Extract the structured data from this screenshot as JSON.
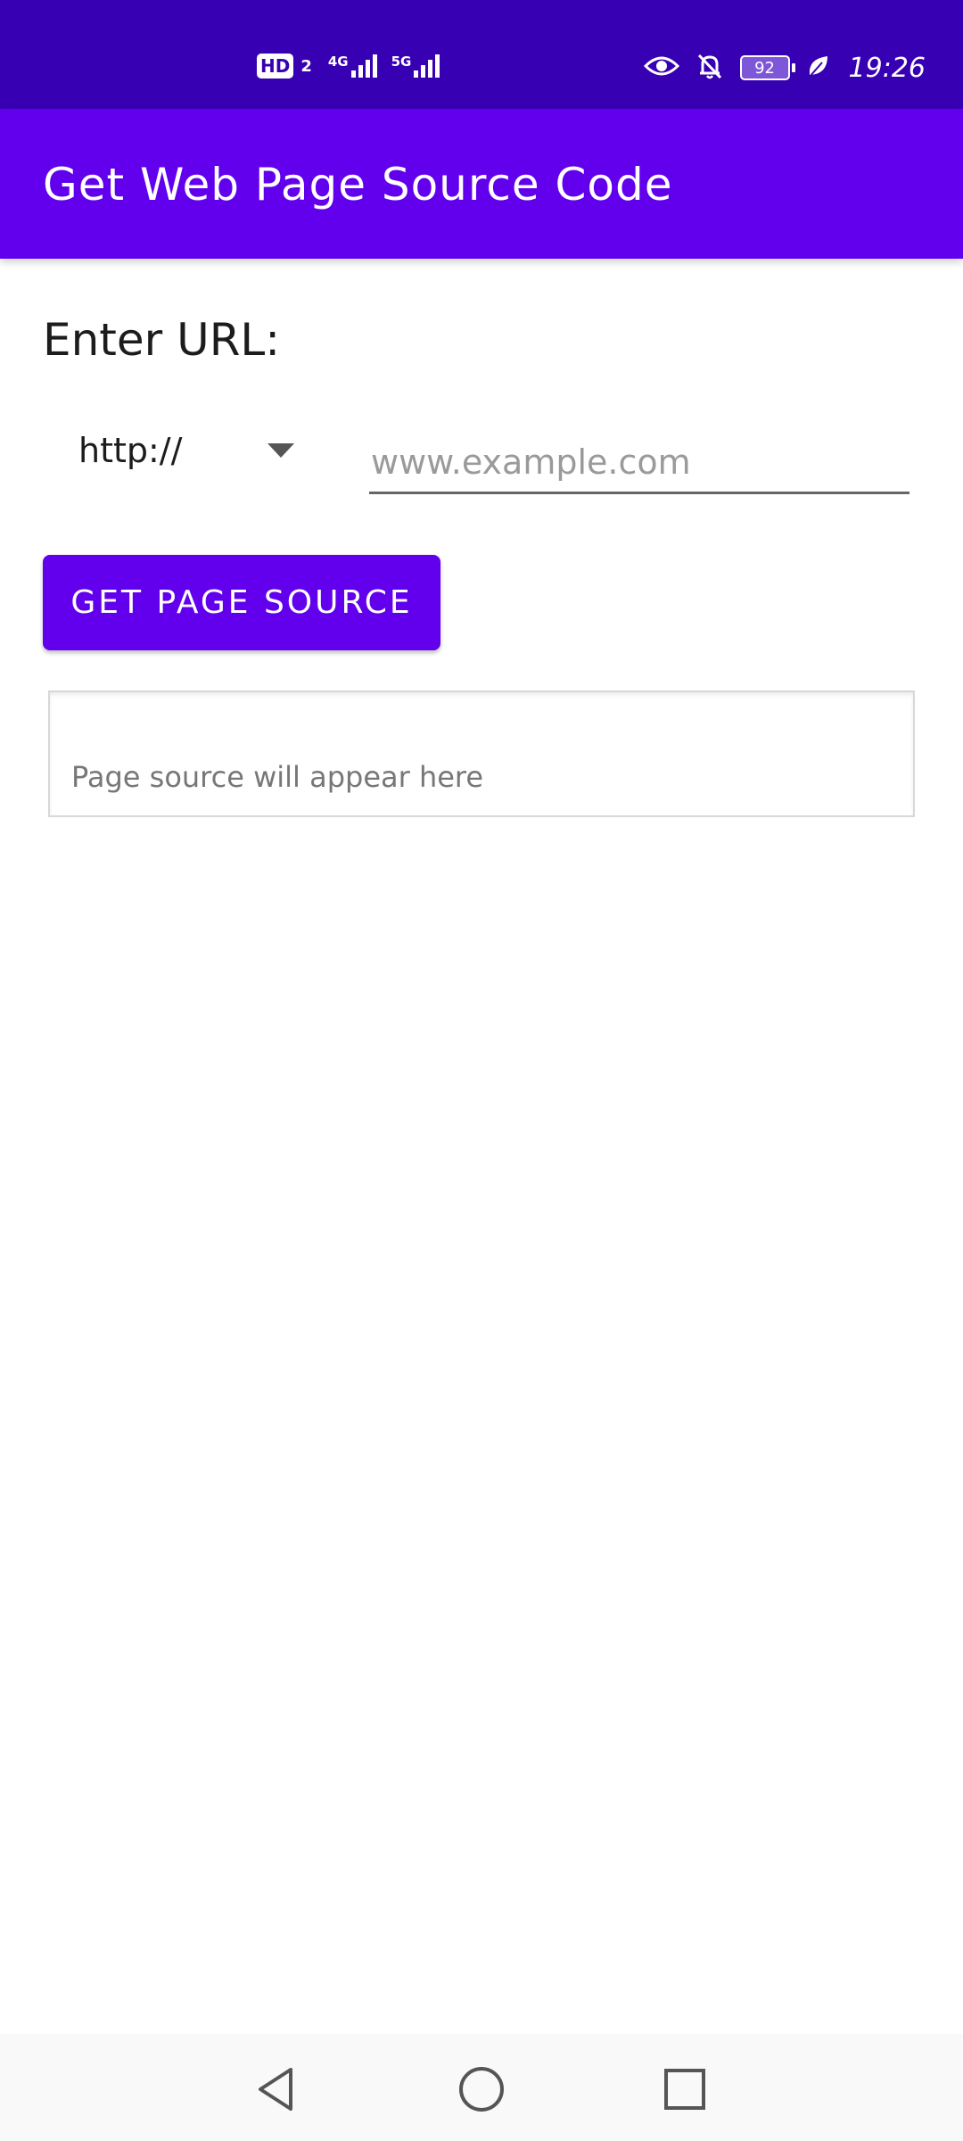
{
  "status_bar": {
    "hd_label": "HD",
    "sim_number": "2",
    "network_1": "4G",
    "network_2": "5G",
    "battery_level": "92",
    "time": "19:26"
  },
  "app_bar": {
    "title": "Get Web Page Source Code"
  },
  "form": {
    "url_label": "Enter URL:",
    "protocol_selected": "http://",
    "url_input": {
      "value": "",
      "placeholder": "www.example.com"
    },
    "submit_label": "GET PAGE SOURCE"
  },
  "output": {
    "placeholder_text": "Page source will appear here"
  },
  "colors": {
    "status_bar": "#3700b3",
    "primary": "#6200ee"
  },
  "nav_bar": {
    "icons": [
      "back-icon",
      "home-icon",
      "recents-icon"
    ]
  }
}
